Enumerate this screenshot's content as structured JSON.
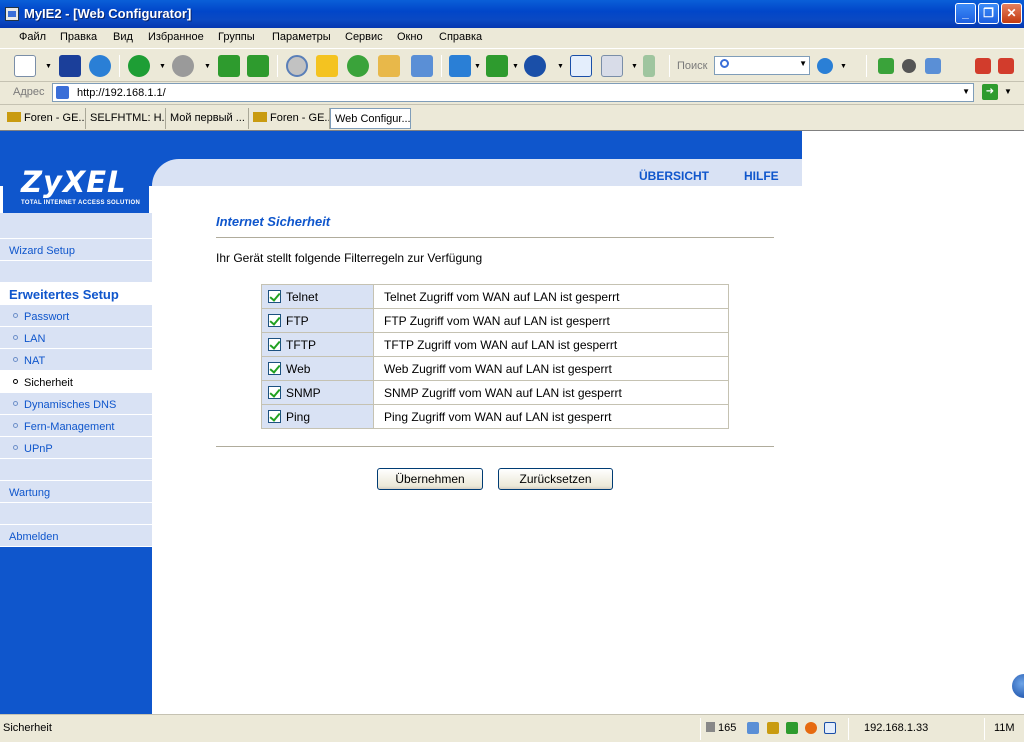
{
  "window": {
    "title": "MyIE2 - [Web Configurator]",
    "minimize_icon": "minimize-icon",
    "maximize_icon": "restore-icon",
    "close_icon": "close-icon"
  },
  "menu": {
    "items": [
      "Файл",
      "Правка",
      "Вид",
      "Избранное",
      "Группы",
      "Параметры",
      "Сервис",
      "Окно",
      "Справка"
    ]
  },
  "toolbar": {
    "search_label": "Поиск",
    "search_value": "",
    "icons": [
      "new-page-icon",
      "save-icon",
      "globe-network-icon",
      "back-icon",
      "forward-icon",
      "refresh-icon",
      "refresh-all-icon",
      "search-icon",
      "favorites-star-icon",
      "history-icon",
      "folder-icon",
      "notepad-icon",
      "font-size-icon",
      "translate-icon",
      "browser-globe-icon",
      "fullscreen-icon",
      "mail-icon",
      "more-icon",
      "collector-icon",
      "skull-icon",
      "puzzle-icon",
      "close-page-icon",
      "close-all-icon"
    ]
  },
  "address": {
    "label": "Адрес",
    "url": "http://192.168.1.1/"
  },
  "tabs": [
    {
      "label": "Foren - GE..."
    },
    {
      "label": "SELFHTML: H..."
    },
    {
      "label": "Мой первый ..."
    },
    {
      "label": "Foren - GE..."
    },
    {
      "label": "Web Configur..."
    }
  ],
  "page": {
    "brand": "ZyXEL",
    "tagline": "TOTAL INTERNET ACCESS SOLUTION",
    "top_links": {
      "overview": "ÜBERSICHT",
      "help": "HILFE"
    },
    "sidebar": {
      "wizard": "Wizard Setup",
      "advanced": "Erweitertes Setup",
      "sub": [
        "Passwort",
        "LAN",
        "NAT",
        "Sicherheit",
        "Dynamisches DNS",
        "Fern-Management",
        "UPnP"
      ],
      "maintenance": "Wartung",
      "logout": "Abmelden"
    },
    "title": "Internet Sicherheit",
    "intro": "Ihr Gerät stellt folgende Filterregeln zur Verfügung",
    "filters": [
      {
        "name": "Telnet",
        "checked": true,
        "description": "Telnet Zugriff vom WAN auf LAN ist gesperrt"
      },
      {
        "name": "FTP",
        "checked": true,
        "description": "FTP Zugriff vom WAN auf LAN ist gesperrt"
      },
      {
        "name": "TFTP",
        "checked": true,
        "description": "TFTP Zugriff vom WAN auf LAN ist gesperrt"
      },
      {
        "name": "Web",
        "checked": true,
        "description": "Web Zugriff vom WAN auf LAN ist gesperrt"
      },
      {
        "name": "SNMP",
        "checked": true,
        "description": "SNMP Zugriff vom WAN auf LAN ist gesperrt"
      },
      {
        "name": "Ping",
        "checked": true,
        "description": "Ping Zugriff vom WAN auf LAN ist gesperrt"
      }
    ],
    "apply_label": "Übernehmen",
    "reset_label": "Zurücksetzen"
  },
  "status": {
    "text": "Sicherheit",
    "count": "165",
    "ip": "192.168.1.33",
    "memory": "11M"
  },
  "colors": {
    "zyxel_blue": "#0f56cc",
    "panel_light": "#d9e2f4",
    "xp_titlebar": "#0a5fd8"
  }
}
